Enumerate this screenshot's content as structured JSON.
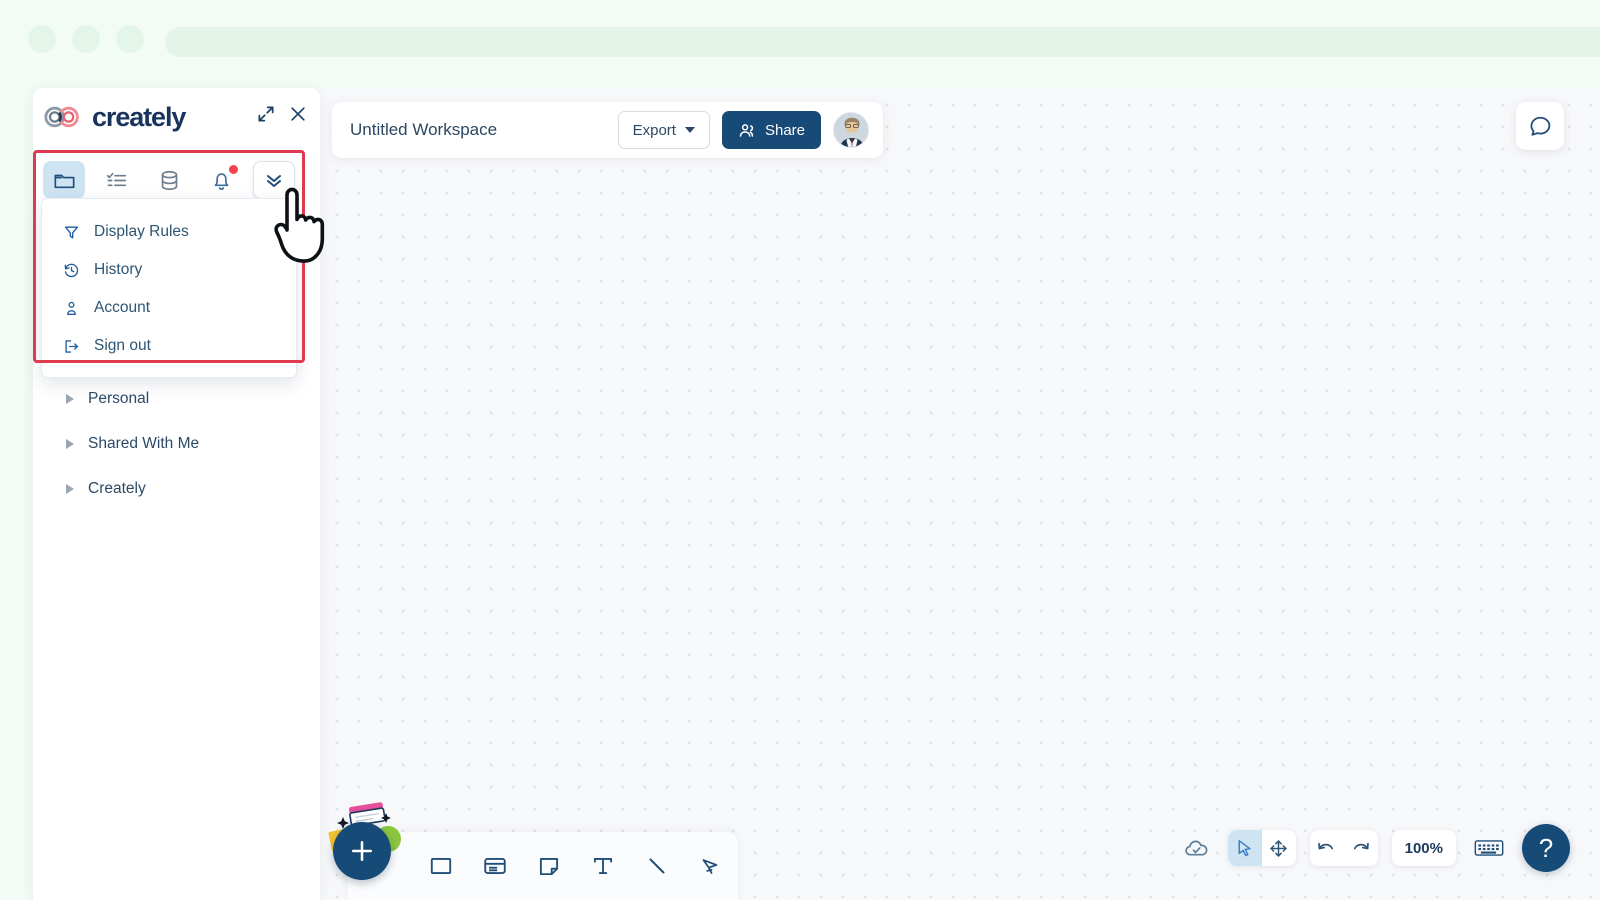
{
  "browser": {
    "dots": [
      "window-dot-1",
      "window-dot-2",
      "window-dot-3"
    ],
    "urlbar_value": ""
  },
  "sidebar": {
    "logo_text": "creately",
    "header_actions": [
      {
        "name": "expand-icon",
        "label": "Expand"
      },
      {
        "name": "close-icon",
        "label": "Close"
      }
    ],
    "tabs": [
      {
        "name": "tab-folders",
        "icon": "folder-icon",
        "label": "Folders",
        "active": true
      },
      {
        "name": "tab-tasks",
        "icon": "checklist-icon",
        "label": "Tasks",
        "active": false
      },
      {
        "name": "tab-data",
        "icon": "database-icon",
        "label": "Data",
        "active": false
      },
      {
        "name": "tab-notifications",
        "icon": "bell-icon",
        "label": "Notifications",
        "active": false,
        "badge": true
      },
      {
        "name": "tab-more",
        "icon": "chevrons-down-icon",
        "label": "More",
        "active": false,
        "boxed": true
      }
    ],
    "dropdown": {
      "open": true,
      "items": [
        {
          "icon": "filter-icon",
          "label": "Display Rules"
        },
        {
          "icon": "history-icon",
          "label": "History"
        },
        {
          "icon": "user-icon",
          "label": "Account"
        },
        {
          "icon": "sign-out-icon",
          "label": "Sign out"
        }
      ]
    },
    "tree": [
      {
        "label": "Personal",
        "expanded": false
      },
      {
        "label": "Shared With Me",
        "expanded": false
      },
      {
        "label": "Creately",
        "expanded": false
      }
    ]
  },
  "workspace": {
    "title": "Untitled Workspace",
    "title_placeholder": "Untitled Workspace",
    "export_label": "Export",
    "share_label": "Share",
    "avatar_alt": "User avatar"
  },
  "canvas": {
    "chat_label": "Comments"
  },
  "shape_toolbar": {
    "add_label": "+",
    "tools": [
      {
        "name": "shape-rectangle-tool",
        "icon": "rectangle-icon",
        "label": "Rectangle"
      },
      {
        "name": "shape-card-tool",
        "icon": "card-icon",
        "label": "Card"
      },
      {
        "name": "shape-note-tool",
        "icon": "sticky-note-icon",
        "label": "Note"
      },
      {
        "name": "shape-text-tool",
        "icon": "text-icon",
        "label": "Text"
      },
      {
        "name": "shape-line-tool",
        "icon": "line-icon",
        "label": "Line"
      },
      {
        "name": "shape-freehand-tool",
        "icon": "pen-icon",
        "label": "Freehand"
      }
    ]
  },
  "bottom_right": {
    "sync_label": "Saved",
    "select_label": "Select",
    "pan_label": "Pan",
    "undo_label": "Undo",
    "redo_label": "Redo",
    "zoom_level": "100%",
    "keyboard_label": "Keyboard shortcuts",
    "help_label": "?"
  },
  "colors": {
    "brand_navy": "#164a77",
    "accent_blue": "#3b7fc4",
    "highlight_red": "#e03a4e",
    "badge_red": "#f4424f",
    "active_tab_bg": "#cfe4f3",
    "chrome_green": "#f2fbf5"
  },
  "annotation": {
    "highlight_target": "sidebar-toolbar-and-more-menu",
    "cursor": "pointing-hand"
  }
}
